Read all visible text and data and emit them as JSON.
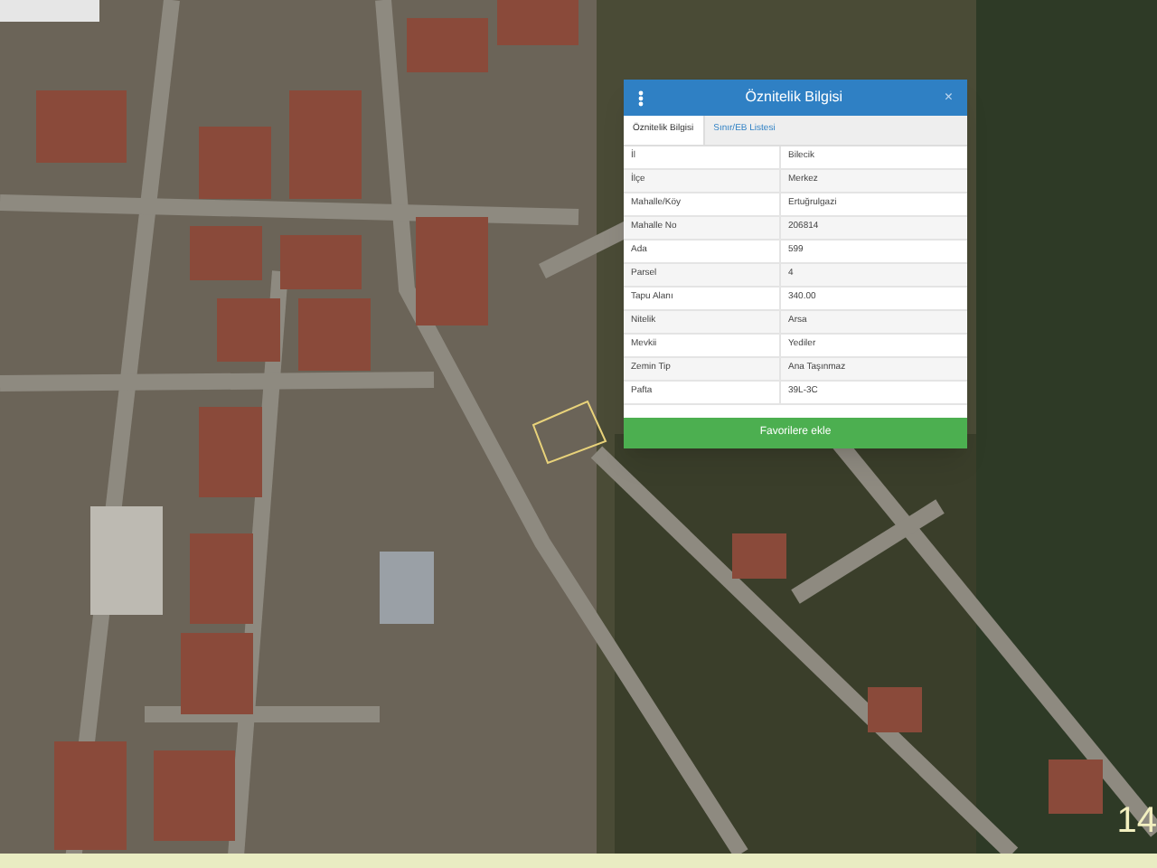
{
  "popup": {
    "title": "Öznitelik Bilgisi",
    "close": "×",
    "tabs": [
      {
        "label": "Öznitelik Bilgisi",
        "selected": true
      },
      {
        "label": "Sınır/EB Listesi",
        "selected": false
      }
    ],
    "rows": [
      {
        "label": "İl",
        "value": "Bilecik"
      },
      {
        "label": "İlçe",
        "value": "Merkez"
      },
      {
        "label": "Mahalle/Köy",
        "value": "Ertuğrulgazi"
      },
      {
        "label": "Mahalle No",
        "value": "206814"
      },
      {
        "label": "Ada",
        "value": "599"
      },
      {
        "label": "Parsel",
        "value": "4"
      },
      {
        "label": "Tapu Alanı",
        "value": "340.00"
      },
      {
        "label": "Nitelik",
        "value": "Arsa"
      },
      {
        "label": "Mevkii",
        "value": "Yediler"
      },
      {
        "label": "Zemin Tip",
        "value": "Ana Taşınmaz"
      },
      {
        "label": "Pafta",
        "value": "39L-3C"
      }
    ],
    "button": "Favorilere ekle"
  },
  "zoom_level": "14"
}
